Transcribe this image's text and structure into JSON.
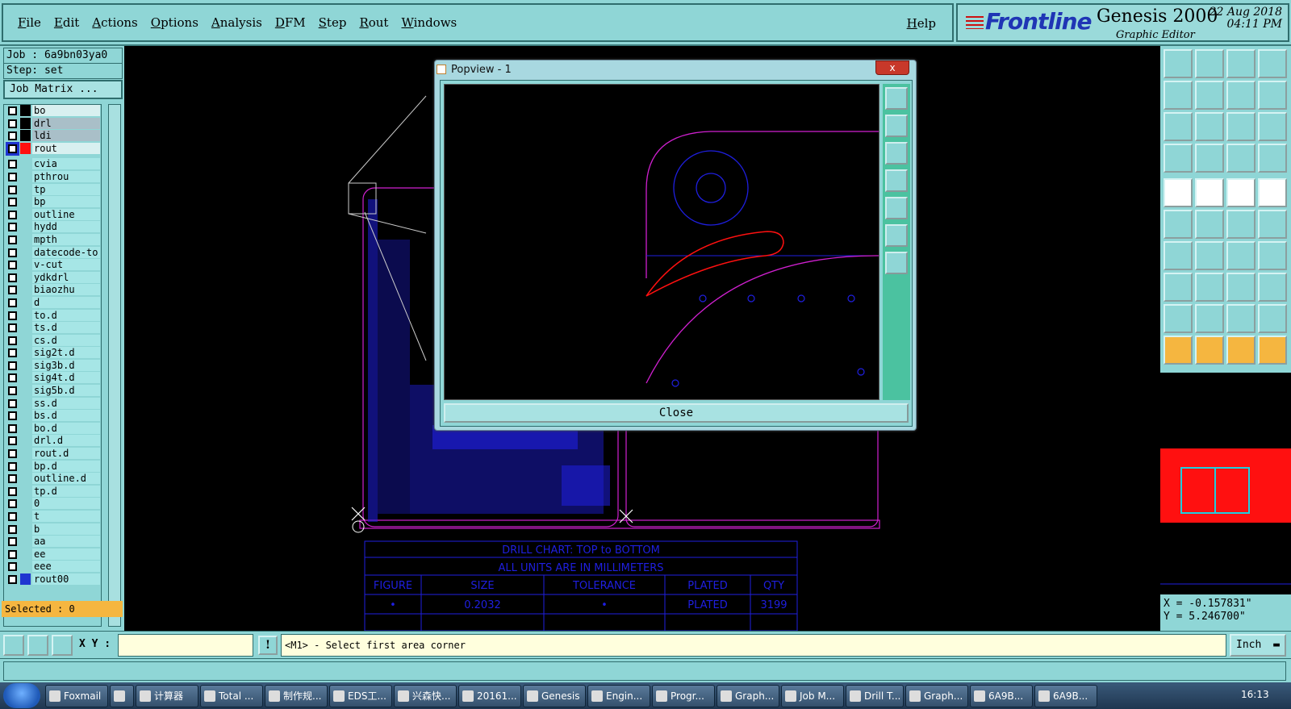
{
  "menu": {
    "items": [
      "File",
      "Edit",
      "Actions",
      "Options",
      "Analysis",
      "DFM",
      "Step",
      "Rout",
      "Windows"
    ],
    "help": "Help"
  },
  "brand": {
    "logo": "Frontline",
    "product": "Genesis 2000",
    "subtitle": "Graphic Editor",
    "date": "22 Aug 2018",
    "time": "04:11 PM"
  },
  "left": {
    "job": "Job : 6a9bn03ya0",
    "step": "Step: set",
    "job_matrix": "Job Matrix ...",
    "selected": "Selected : 0",
    "layers": [
      {
        "name": "bo",
        "color": "#000000",
        "style": "active"
      },
      {
        "name": "drl",
        "color": "#000000",
        "style": "sel"
      },
      {
        "name": "ldi",
        "color": "#000000",
        "style": "sel"
      },
      {
        "name": "rout",
        "color": "#ff1010",
        "style": "active",
        "cb_color": "#1f35d0"
      },
      {
        "name": "cvia",
        "color": "",
        "style": ""
      },
      {
        "name": "pthrou",
        "color": "",
        "style": ""
      },
      {
        "name": "tp",
        "color": "",
        "style": ""
      },
      {
        "name": "bp",
        "color": "",
        "style": ""
      },
      {
        "name": "outline",
        "color": "",
        "style": ""
      },
      {
        "name": "hydd",
        "color": "",
        "style": ""
      },
      {
        "name": "mpth",
        "color": "",
        "style": ""
      },
      {
        "name": "datecode-to",
        "color": "",
        "style": ""
      },
      {
        "name": "v-cut",
        "color": "",
        "style": ""
      },
      {
        "name": "ydkdrl",
        "color": "",
        "style": ""
      },
      {
        "name": "biaozhu",
        "color": "",
        "style": ""
      },
      {
        "name": "d",
        "color": "",
        "style": ""
      },
      {
        "name": "to.d",
        "color": "",
        "style": ""
      },
      {
        "name": "ts.d",
        "color": "",
        "style": ""
      },
      {
        "name": "cs.d",
        "color": "",
        "style": ""
      },
      {
        "name": "sig2t.d",
        "color": "",
        "style": ""
      },
      {
        "name": "sig3b.d",
        "color": "",
        "style": ""
      },
      {
        "name": "sig4t.d",
        "color": "",
        "style": ""
      },
      {
        "name": "sig5b.d",
        "color": "",
        "style": ""
      },
      {
        "name": "ss.d",
        "color": "",
        "style": ""
      },
      {
        "name": "bs.d",
        "color": "",
        "style": ""
      },
      {
        "name": "bo.d",
        "color": "",
        "style": ""
      },
      {
        "name": "drl.d",
        "color": "",
        "style": ""
      },
      {
        "name": "rout.d",
        "color": "",
        "style": ""
      },
      {
        "name": "bp.d",
        "color": "",
        "style": ""
      },
      {
        "name": "outline.d",
        "color": "",
        "style": ""
      },
      {
        "name": "tp.d",
        "color": "",
        "style": ""
      },
      {
        "name": "0",
        "color": "",
        "style": ""
      },
      {
        "name": "t",
        "color": "",
        "style": ""
      },
      {
        "name": "b",
        "color": "",
        "style": ""
      },
      {
        "name": "aa",
        "color": "",
        "style": ""
      },
      {
        "name": "ee",
        "color": "",
        "style": ""
      },
      {
        "name": "eee",
        "color": "",
        "style": ""
      },
      {
        "name": "rout00",
        "color": "#1f35d0",
        "style": ""
      }
    ]
  },
  "popview": {
    "title": "Popview - 1",
    "close_x": "x",
    "close_label": "Close"
  },
  "drill_chart": {
    "title": "DRILL CHART: TOP to BOTTOM",
    "subtitle": "ALL UNITS ARE IN MILLIMETERS",
    "headers": [
      "FIGURE",
      "SIZE",
      "TOLERANCE",
      "PLATED",
      "QTY"
    ],
    "row": [
      "•",
      "0.2032",
      "•",
      "PLATED",
      "3199"
    ]
  },
  "coords": {
    "x": "X = -0.157831\"",
    "y": "Y = 5.246700\""
  },
  "command": {
    "xy_label": "X Y :",
    "xy_value": "",
    "excl": "!",
    "prompt": "<M1> - Select first area corner",
    "units": "Inch"
  },
  "taskbar": {
    "items": [
      "Foxmail",
      "",
      "计算器",
      "Total ...",
      "制作规...",
      "EDS工...",
      "兴森快...",
      "20161...",
      "Genesis",
      "Engin...",
      "Progr...",
      "Graph...",
      "Job M...",
      "Drill T...",
      "Graph...",
      "6A9B...",
      "6A9B..."
    ],
    "clock": "16:13"
  },
  "colors": {
    "panel": "#8fd6d6",
    "accent_orange": "#f5b640",
    "trace_blue": "#1f1fe0",
    "outline_magenta": "#d020d0",
    "rout_red": "#ff1010"
  }
}
